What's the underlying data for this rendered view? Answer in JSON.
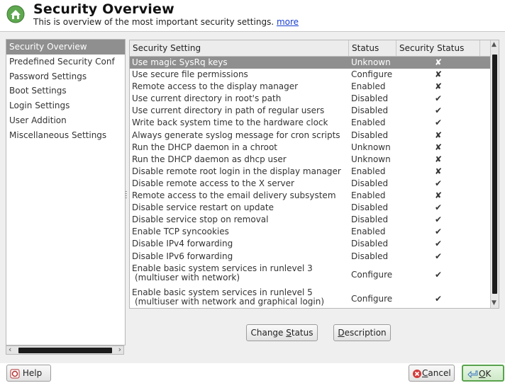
{
  "header": {
    "title": "Security Overview",
    "subtitle": "This is overview of the most important security settings.",
    "more_link": "more",
    "logo_icon": "yast-security-icon"
  },
  "sidebar": {
    "items": [
      {
        "label": "Security Overview",
        "selected": true
      },
      {
        "label": "Predefined Security Conf",
        "selected": false
      },
      {
        "label": "Password Settings",
        "selected": false
      },
      {
        "label": "Boot Settings",
        "selected": false
      },
      {
        "label": "Login Settings",
        "selected": false
      },
      {
        "label": "User Addition",
        "selected": false
      },
      {
        "label": "Miscellaneous Settings",
        "selected": false
      }
    ]
  },
  "table": {
    "columns": [
      "Security Setting",
      "Status",
      "Security Status"
    ],
    "rows": [
      {
        "setting": "Use magic SysRq keys",
        "status": "Unknown",
        "security": "✘",
        "selected": true
      },
      {
        "setting": "Use secure file permissions",
        "status": "Configure",
        "security": "✘"
      },
      {
        "setting": "Remote access to the display manager",
        "status": "Enabled",
        "security": "✘"
      },
      {
        "setting": "Use current directory in root's path",
        "status": "Disabled",
        "security": "✔"
      },
      {
        "setting": "Use current directory in path of regular users",
        "status": "Disabled",
        "security": "✔"
      },
      {
        "setting": "Write back system time to the hardware clock",
        "status": "Enabled",
        "security": "✔"
      },
      {
        "setting": "Always generate syslog message for cron scripts",
        "status": "Disabled",
        "security": "✘"
      },
      {
        "setting": "Run the DHCP daemon in a chroot",
        "status": "Unknown",
        "security": "✘"
      },
      {
        "setting": "Run the DHCP daemon as dhcp user",
        "status": "Unknown",
        "security": "✘"
      },
      {
        "setting": "Disable remote root login in the display manager",
        "status": "Enabled",
        "security": "✘"
      },
      {
        "setting": "Disable remote access to the X server",
        "status": "Disabled",
        "security": "✔"
      },
      {
        "setting": "Remote access to the email delivery subsystem",
        "status": "Enabled",
        "security": "✘"
      },
      {
        "setting": "Disable service restart on update",
        "status": "Disabled",
        "security": "✔"
      },
      {
        "setting": "Disable service stop on removal",
        "status": "Disabled",
        "security": "✔"
      },
      {
        "setting": "Enable TCP syncookies",
        "status": "Enabled",
        "security": "✔"
      },
      {
        "setting": "Disable IPv4 forwarding",
        "status": "Disabled",
        "security": "✔"
      },
      {
        "setting": "Disable IPv6 forwarding",
        "status": "Disabled",
        "security": "✔"
      },
      {
        "setting": "Enable basic system services in runlevel 3",
        "setting2": "(multiuser with network)",
        "status": "Configure",
        "security": "✔",
        "tall": true
      },
      {
        "setting": "Enable basic system services in runlevel 5",
        "setting2": "(multiuser with network and graphical login)",
        "status": "Configure",
        "security": "✔",
        "tall": true
      }
    ]
  },
  "buttons": {
    "change_status": {
      "pre": "Change ",
      "key": "S",
      "post": "tatus"
    },
    "description": {
      "pre": "",
      "key": "D",
      "post": "escription"
    },
    "help": "Help",
    "cancel": {
      "pre": "",
      "key": "C",
      "post": "ancel"
    },
    "ok": {
      "pre": "",
      "key": "O",
      "post": "K"
    }
  },
  "colors": {
    "selection": "#8f8f8f",
    "link": "#1a3fcf",
    "ok_border": "#58a34d"
  }
}
